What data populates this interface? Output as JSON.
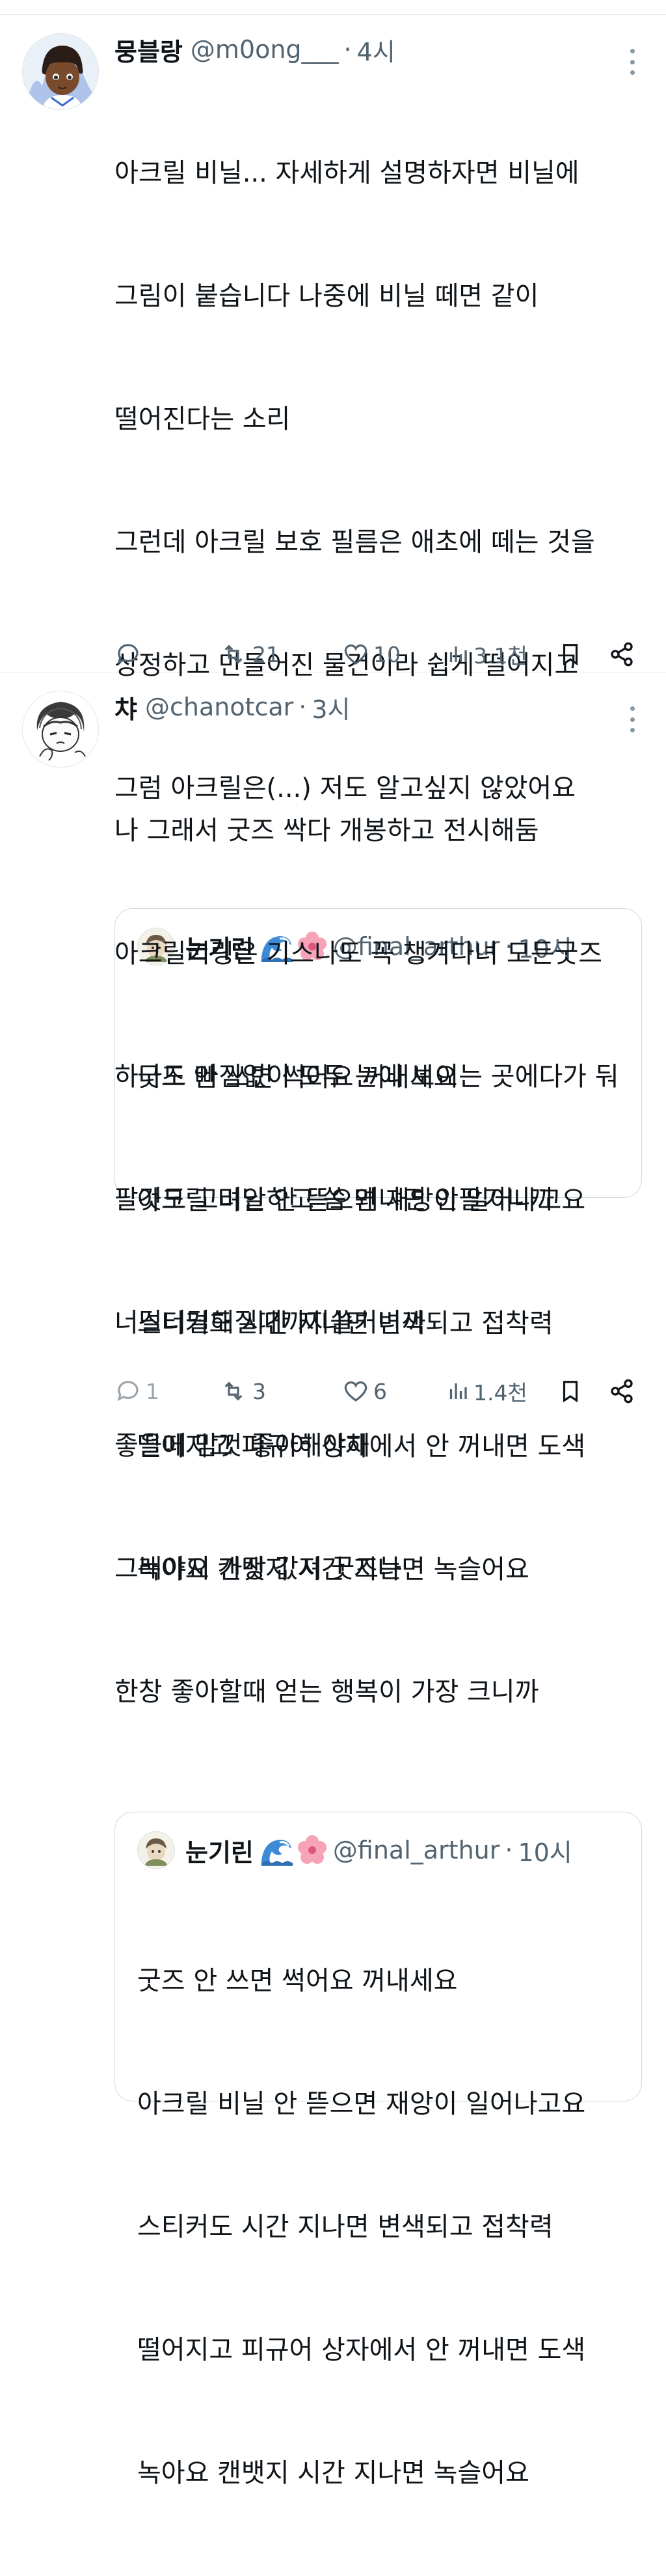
{
  "tweets": [
    {
      "author": {
        "name": "뭉블랑",
        "handle": "@m0ong___",
        "time": "4시"
      },
      "lines": [
        "아크릴 비닐... 자세하게 설명하자면 비닐에",
        "그림이 붙습니다 나중에 비닐 떼면 같이",
        "떨어진다는 소리",
        "그런데 아크릴 보호 필름은 애초에 떼는 것을",
        "상정하고 만들어진 물건이라 쉽게 떨어지고",
        "그럼 아크릴은(...) 저도 알고싶지 않았어요"
      ],
      "quote": {
        "name": "눈기린",
        "emojis": [
          "wave-emoji",
          "blossom-emoji"
        ],
        "handle": "@final_arthur",
        "time": "10시",
        "lines": [
          "굿즈 안 쓰면 썩어요 꺼내세요",
          "아크릴 비닐 안 뜯으면 재앙이 일어나고요",
          "스티커도 시간 지나면 변색되고 접착력",
          "떨어지고 피규어 상자에서 안 꺼내면 도색",
          "녹아요 캔뱃지 시간 지나면 녹슬어요"
        ]
      },
      "actions": {
        "reply": "",
        "retweet": "21",
        "like": "10",
        "views": "3.1천"
      }
    },
    {
      "author": {
        "name": "챠",
        "handle": "@chanotcar",
        "time": "3시"
      },
      "lines": [
        "나 그래서 굿즈 싹다 개봉하고 전시해둠",
        "아크릴키링은 기스나도 꼭 챙겨다녀 모든굿즈",
        "하나도 빠짐없이 모두 눈에 보이는 곳에다가 둬",
        "팔것도 고려안하고 씀 왜냐면 안팔거니까",
        "너덜너덜해질때까지쓸거니까",
        "좋을때 맘껏 좋아해야해",
        "그래야지 가장 값져 굿즈는",
        "한창 좋아할때 얻는 행복이 가장 크니까"
      ],
      "quote": {
        "name": "눈기린",
        "emojis": [
          "wave-emoji",
          "blossom-emoji"
        ],
        "handle": "@final_arthur",
        "time": "10시",
        "lines": [
          "굿즈 안 쓰면 썩어요 꺼내세요",
          "아크릴 비닐 안 뜯으면 재앙이 일어나고요",
          "스티커도 시간 지나면 변색되고 접착력",
          "떨어지고 피규어 상자에서 안 꺼내면 도색",
          "녹아요 캔뱃지 시간 지나면 녹슬어요"
        ]
      },
      "actions": {
        "reply": "1",
        "retweet": "3",
        "like": "6",
        "views": "1.4천"
      }
    }
  ],
  "dot_separator": "·",
  "colors": {
    "text": "#0f1419",
    "secondary": "#536471",
    "border": "#cfd9de",
    "divider": "#e6e9ec"
  }
}
